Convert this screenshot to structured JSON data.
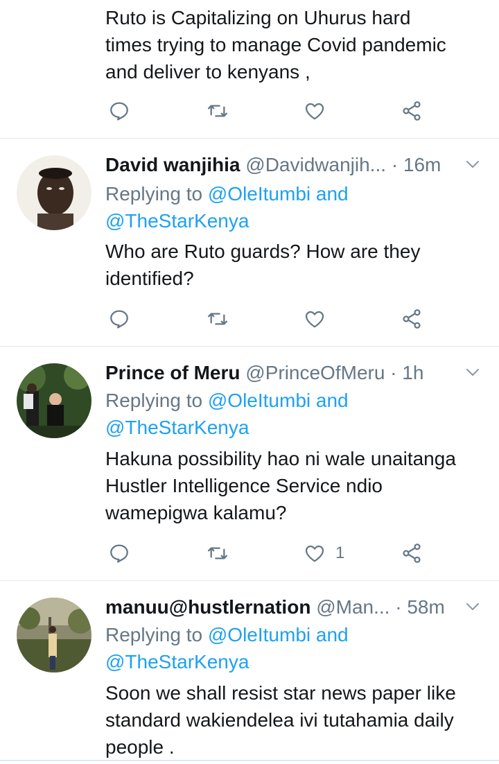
{
  "colors": {
    "link": "#1da1f2",
    "muted": "#657786",
    "text": "#14171a",
    "divider": "#e1e8ed"
  },
  "tweets": [
    {
      "body": [
        "Ruto is Capitalizing on Uhurus hard",
        "times trying to manage Covid pandemic",
        "and deliver to kenyans ,"
      ],
      "actions": {
        "reply_icon": "reply-icon",
        "retweet_icon": "retweet-icon",
        "like_icon": "like-icon",
        "share_icon": "share-icon",
        "like_count": ""
      }
    },
    {
      "name": "David wanjihia",
      "handle": "@Davidwanjih...",
      "sep": " · ",
      "time": "16m",
      "replying_prefix": "Replying to ",
      "replying_to": [
        "@OleItumbi",
        "@TheStarKenya"
      ],
      "replying_and": " and",
      "body": [
        "Who are Ruto guards? How are they",
        "identified?"
      ],
      "actions": {
        "like_count": ""
      }
    },
    {
      "name": "Prince of Meru",
      "handle": "@PrinceOfMeru",
      "sep": " · ",
      "time": "1h",
      "replying_prefix": "Replying to ",
      "replying_to": [
        "@OleItumbi",
        "@TheStarKenya"
      ],
      "replying_and": " and",
      "body": [
        "Hakuna possibility hao ni wale unaitanga",
        "Hustler Intelligence Service ndio",
        "wamepigwa kalamu?"
      ],
      "actions": {
        "like_count": "1"
      }
    },
    {
      "name": "manuu@hustlernation",
      "handle": "@Man...",
      "sep": " · ",
      "time": "58m",
      "replying_prefix": "Replying to ",
      "replying_to": [
        "@OleItumbi",
        "@TheStarKenya"
      ],
      "replying_and": " and",
      "body": [
        "Soon we shall resist star news paper like",
        "standard wakiendelea ivi tutahamia daily",
        "people ."
      ],
      "actions": {
        "like_count": ""
      }
    }
  ]
}
